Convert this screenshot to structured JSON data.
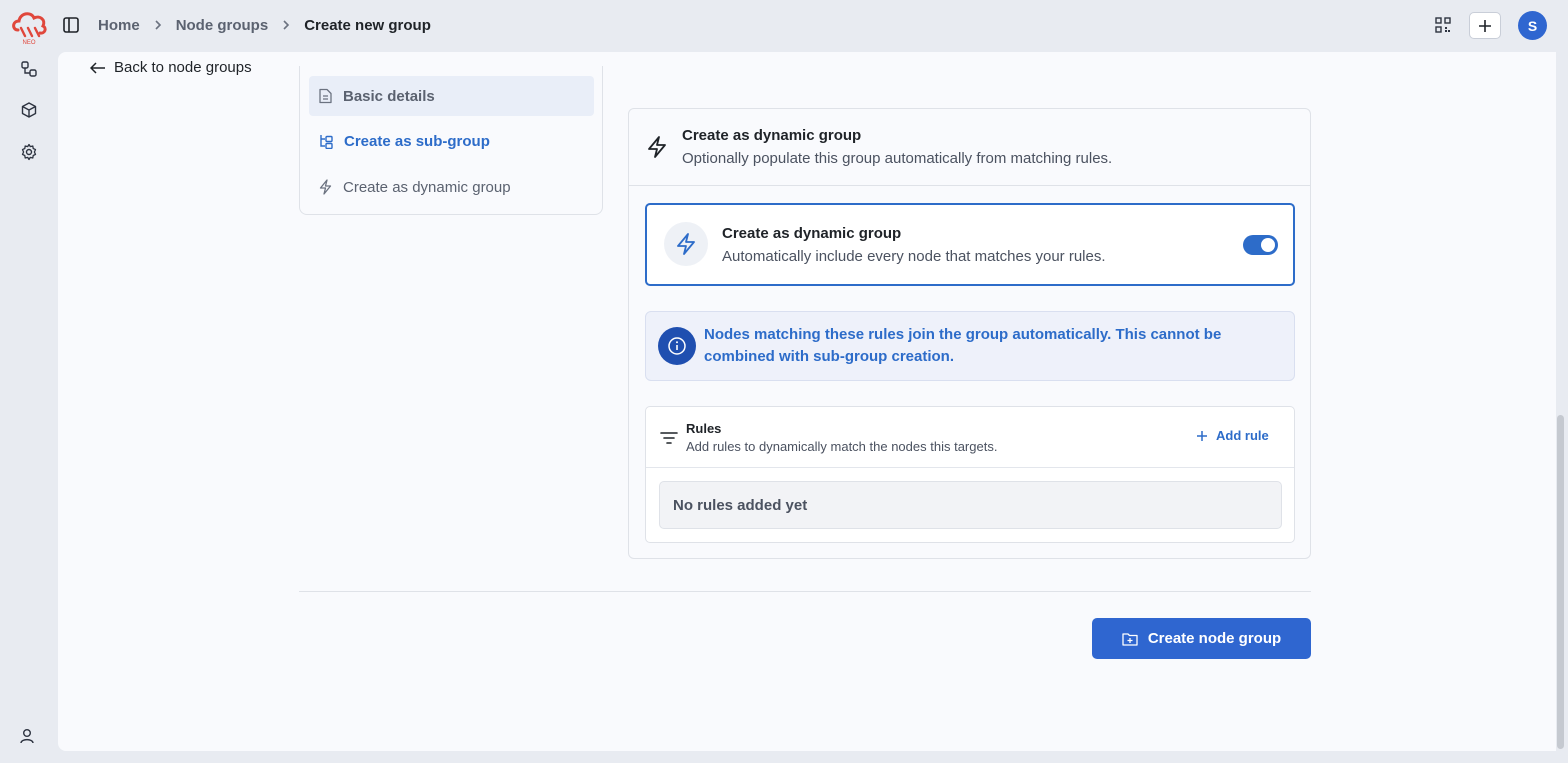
{
  "app": {
    "logo_text": "NEO",
    "user_initial": "S"
  },
  "breadcrumb": {
    "items": [
      "Home",
      "Node groups",
      "Create new group"
    ]
  },
  "back_link": "Back to node groups",
  "steps": [
    {
      "label": "Basic details",
      "icon": "document-icon"
    },
    {
      "label": "Create as sub-group",
      "icon": "hierarchy-icon"
    },
    {
      "label": "Create as dynamic group",
      "icon": "lightning-icon"
    }
  ],
  "section": {
    "title": "Create as dynamic group",
    "description": "Optionally populate this group automatically from matching rules."
  },
  "toggle_card": {
    "title": "Create as dynamic group",
    "description": "Automatically include every node that matches your rules.",
    "enabled": true
  },
  "info": {
    "text": "Nodes matching these rules join the group automatically. This cannot be combined with sub-group creation."
  },
  "rules": {
    "title": "Rules",
    "description": "Add rules to dynamically match the nodes this targets.",
    "add_label": "Add rule",
    "empty_text": "No rules added yet"
  },
  "submit_label": "Create node group",
  "colors": {
    "accent": "#2d6cc9",
    "button": "#2f66d0",
    "logo": "#e0473c"
  }
}
